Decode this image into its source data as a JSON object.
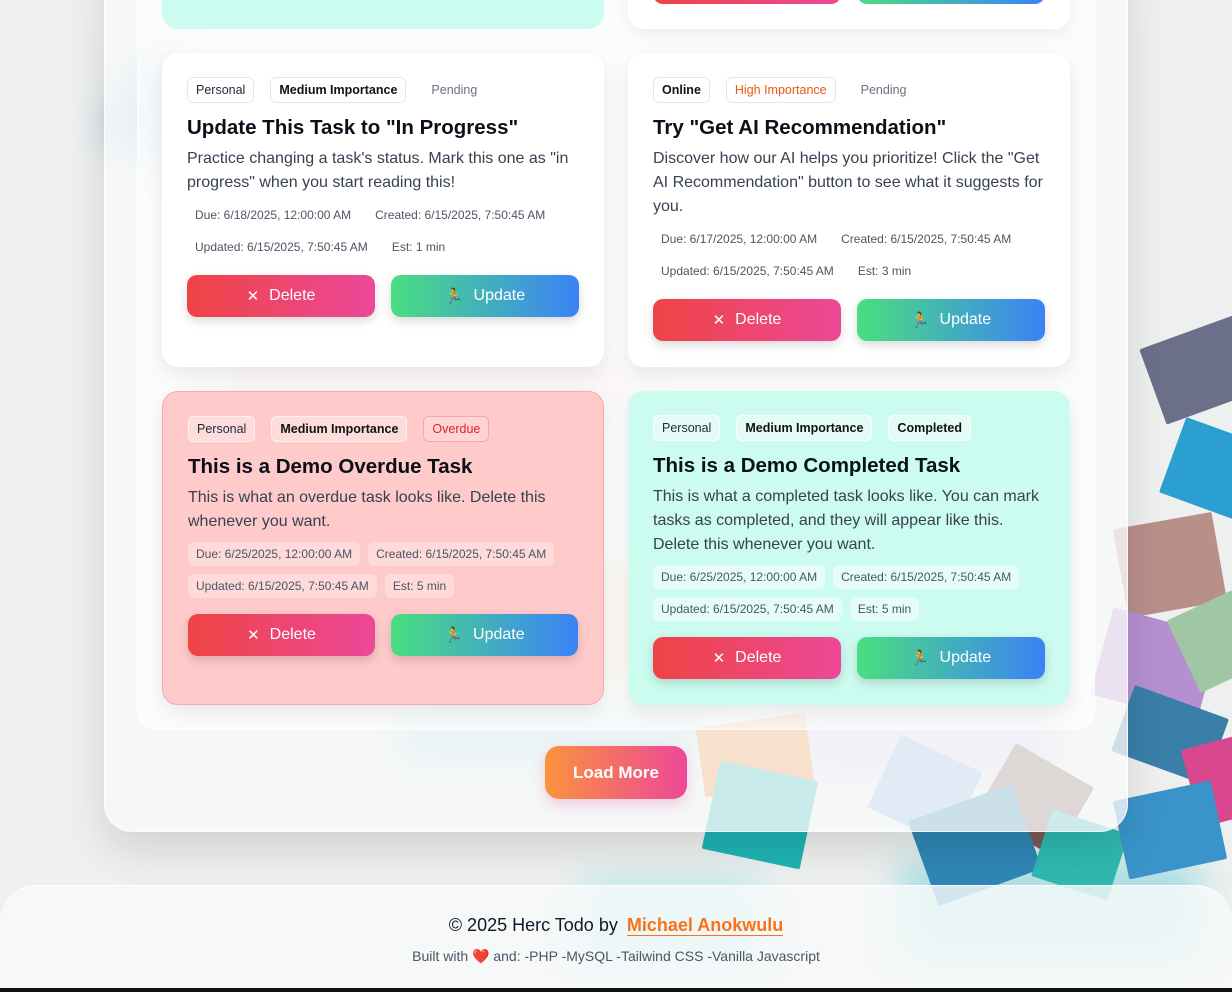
{
  "colors": {
    "delete_gradient": [
      "#ef4444",
      "#ec4899"
    ],
    "update_gradient": [
      "#4ade80",
      "#3b82f6"
    ],
    "load_more_gradient": [
      "#fb923c",
      "#ec4899"
    ],
    "overdue_card": "#fecaca",
    "completed_card": "#ccfbef",
    "author_link": "#f97316"
  },
  "tasks": [
    {
      "tags": [
        "Personal",
        "Medium Importance",
        "Pending"
      ],
      "title": "Update This Task to \"In Progress\"",
      "description": "Practice changing a task's status. Mark this one as \"in progress\" when you start reading this!",
      "due": "Due: 6/18/2025, 12:00:00 AM",
      "created": "Created: 6/15/2025, 7:50:45 AM",
      "updated": "Updated: 6/15/2025, 7:50:45 AM",
      "estimate": "Est: 1 min",
      "delete_label": "Delete",
      "update_label": "Update"
    },
    {
      "tags": [
        "Online",
        "High Importance",
        "Pending"
      ],
      "title": "Try \"Get AI Recommendation\"",
      "description": "Discover how our AI helps you prioritize! Click the \"Get AI Recommendation\" button to see what it suggests for you.",
      "due": "Due: 6/17/2025, 12:00:00 AM",
      "created": "Created: 6/15/2025, 7:50:45 AM",
      "updated": "Updated: 6/15/2025, 7:50:45 AM",
      "estimate": "Est: 3 min",
      "delete_label": "Delete",
      "update_label": "Update"
    },
    {
      "tags": [
        "Personal",
        "Medium Importance",
        "Overdue"
      ],
      "title": "This is a Demo Overdue Task",
      "description": "This is what an overdue task looks like. Delete this whenever you want.",
      "due": "Due: 6/25/2025, 12:00:00 AM",
      "created": "Created: 6/15/2025, 7:50:45 AM",
      "updated": "Updated: 6/15/2025, 7:50:45 AM",
      "estimate": "Est: 5 min",
      "delete_label": "Delete",
      "update_label": "Update"
    },
    {
      "tags": [
        "Personal",
        "Medium Importance",
        "Completed"
      ],
      "title": "This is a Demo Completed Task",
      "description": "This is what a completed task looks like. You can mark tasks as completed, and they will appear like this. Delete this whenever you want.",
      "due": "Due: 6/25/2025, 12:00:00 AM",
      "created": "Created: 6/15/2025, 7:50:45 AM",
      "updated": "Updated: 6/15/2025, 7:50:45 AM",
      "estimate": "Est: 5 min",
      "delete_label": "Delete",
      "update_label": "Update"
    }
  ],
  "load_more_label": "Load More",
  "footer": {
    "copyright": "© 2025 Herc Todo by",
    "author": "Michael Anokwulu",
    "built_with": "Built with",
    "stack": "and: -PHP -MySQL -Tailwind CSS -Vanilla Javascript"
  },
  "icons": {
    "delete": "close-icon",
    "update": "running-figure-icon",
    "heart": "heart-icon"
  }
}
